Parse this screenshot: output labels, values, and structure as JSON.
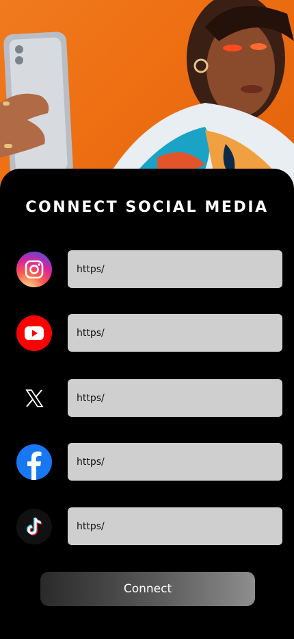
{
  "hero": {
    "icon": "woman-selfie-photo"
  },
  "header": {
    "title": "CONNECT SOCIAL MEDIA"
  },
  "social_links": [
    {
      "platform": "instagram",
      "icon": "instagram-icon",
      "value": "",
      "placeholder": "https/"
    },
    {
      "platform": "youtube",
      "icon": "youtube-icon",
      "value": "",
      "placeholder": "https/"
    },
    {
      "platform": "x",
      "icon": "x-icon",
      "value": "",
      "placeholder": "https/"
    },
    {
      "platform": "facebook",
      "icon": "facebook-icon",
      "value": "",
      "placeholder": "https/"
    },
    {
      "platform": "tiktok",
      "icon": "tiktok-icon",
      "value": "",
      "placeholder": "https/"
    }
  ],
  "actions": {
    "connect_label": "Connect"
  },
  "colors": {
    "background": "#000000",
    "input_fill": "#cfcfcf",
    "hero_orange": "#ee6f12",
    "instagram": "#d6249f",
    "youtube": "#ff0000",
    "facebook": "#1877f2",
    "tiktok_cyan": "#25f4ee",
    "tiktok_red": "#fe2c55"
  }
}
